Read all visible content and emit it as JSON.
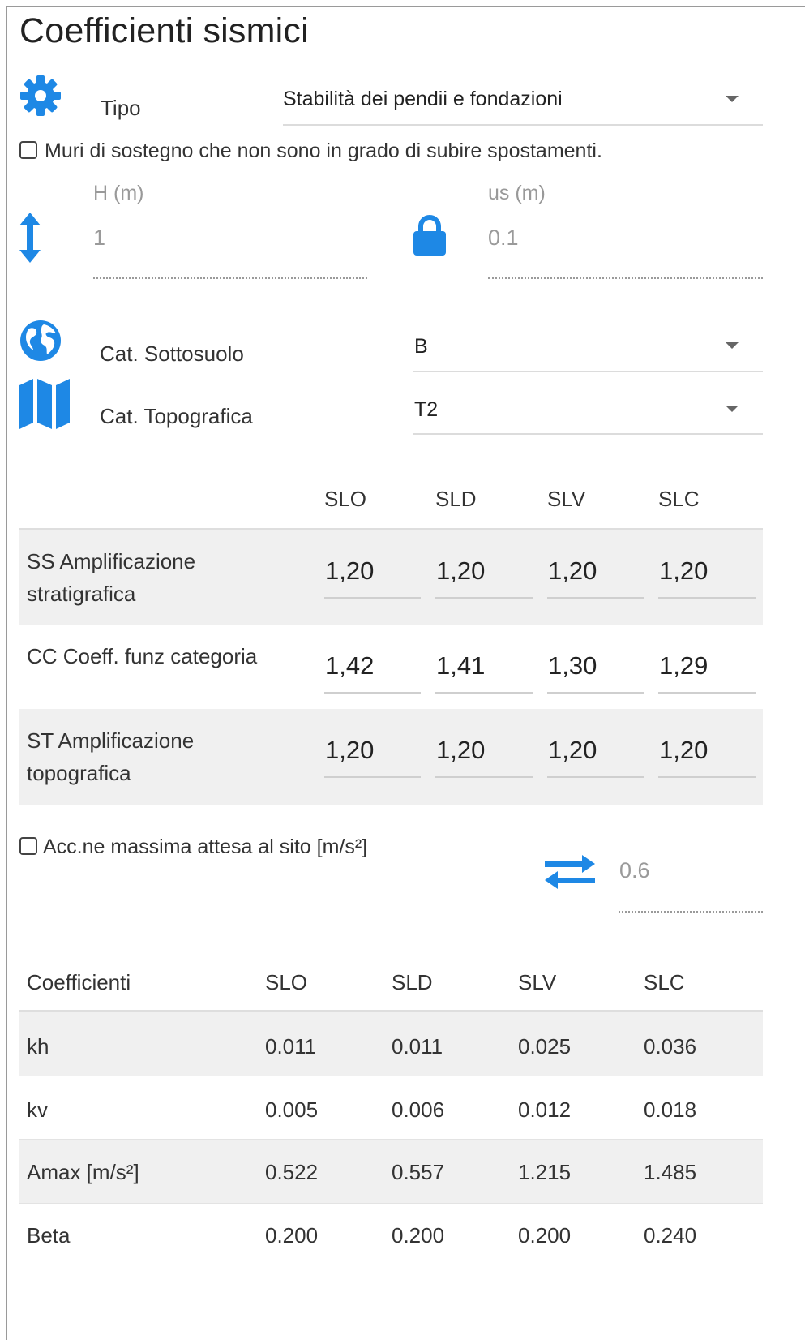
{
  "title": "Coefficienti sismici",
  "colors": {
    "accent": "#1e88e5",
    "row_alt": "#f0f0f0"
  },
  "icons": {
    "tipo": "gear-icon",
    "height": "vertical-arrows-icon",
    "us": "lock-icon",
    "soil": "globe-icon",
    "topo": "map-icon",
    "swap": "swap-arrows-icon",
    "dropdown": "caret-down-icon"
  },
  "tipo": {
    "label": "Tipo",
    "value": "Stabilità dei pendii e fondazioni"
  },
  "muri_checkbox": {
    "label": "Muri di sostegno che non sono in grado di subire spostamenti.",
    "checked": false
  },
  "h_field": {
    "label": "H (m)",
    "value": "1"
  },
  "us_field": {
    "label": "us (m)",
    "value": "0.1"
  },
  "sottosuolo": {
    "label": "Cat. Sottosuolo",
    "value": "B"
  },
  "topografica": {
    "label": "Cat. Topografica",
    "value": "T2"
  },
  "amplif": {
    "headers": [
      "SLO",
      "SLD",
      "SLV",
      "SLC"
    ],
    "rows": [
      {
        "label_line1": "SS Amplificazione",
        "label_line2": "stratigrafica",
        "values": [
          "1,20",
          "1,20",
          "1,20",
          "1,20"
        ]
      },
      {
        "label_line1": "CC Coeff. funz categoria",
        "label_line2": "",
        "values": [
          "1,42",
          "1,41",
          "1,30",
          "1,29"
        ]
      },
      {
        "label_line1": "ST Amplificazione",
        "label_line2": "topografica",
        "values": [
          "1,20",
          "1,20",
          "1,20",
          "1,20"
        ]
      }
    ]
  },
  "acc_checkbox": {
    "label": "Acc.ne massima attesa al sito [m/s²]",
    "checked": false
  },
  "acc_value": "0.6",
  "coeff": {
    "headers": [
      "Coefficienti",
      "SLO",
      "SLD",
      "SLV",
      "SLC"
    ],
    "rows": [
      {
        "label": "kh",
        "values": [
          "0.011",
          "0.011",
          "0.025",
          "0.036"
        ]
      },
      {
        "label": "kv",
        "values": [
          "0.005",
          "0.006",
          "0.012",
          "0.018"
        ]
      },
      {
        "label": "Amax [m/s²]",
        "values": [
          "0.522",
          "0.557",
          "1.215",
          "1.485"
        ]
      },
      {
        "label": "Beta",
        "values": [
          "0.200",
          "0.200",
          "0.200",
          "0.240"
        ]
      }
    ]
  }
}
